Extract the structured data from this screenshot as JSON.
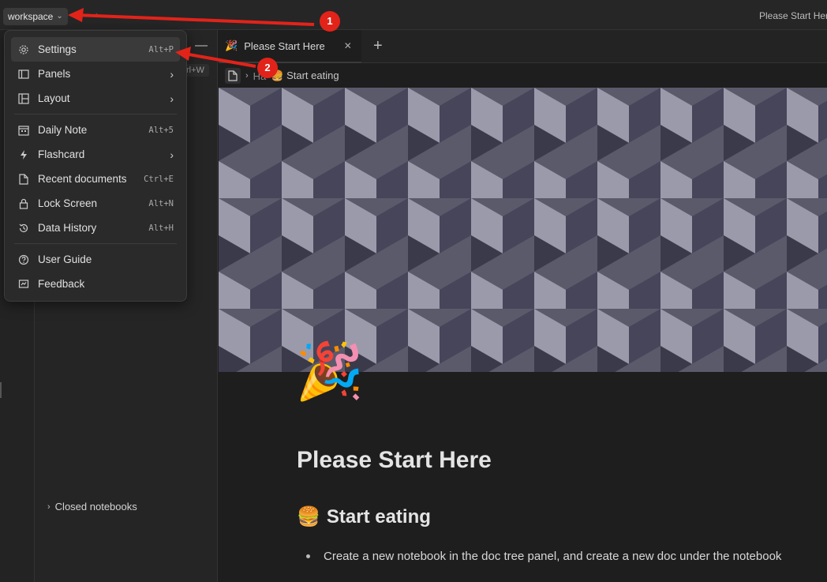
{
  "topbar": {
    "workspace_label": "workspace",
    "title": "Please Start Here"
  },
  "menu": {
    "items": [
      {
        "label": "Settings",
        "shortcut": "Alt+P",
        "icon": "gear-icon"
      },
      {
        "label": "Panels",
        "icon": "panels-icon"
      },
      {
        "label": "Layout",
        "icon": "layout-icon"
      },
      {
        "label": "Daily Note",
        "shortcut": "Alt+5",
        "icon": "calendar-icon"
      },
      {
        "label": "Flashcard",
        "icon": "lightning-icon"
      },
      {
        "label": "Recent documents",
        "shortcut": "Ctrl+E",
        "icon": "document-icon"
      },
      {
        "label": "Lock Screen",
        "shortcut": "Alt+N",
        "icon": "lock-icon"
      },
      {
        "label": "Data History",
        "shortcut": "Alt+H",
        "icon": "history-icon"
      },
      {
        "label": "User Guide",
        "icon": "help-icon"
      },
      {
        "label": "Feedback",
        "icon": "feedback-icon"
      }
    ]
  },
  "tree": {
    "shortcut_hint": "rl+W",
    "closed_notebooks": "Closed notebooks"
  },
  "tab": {
    "emoji": "🎉",
    "label": "Please Start Here"
  },
  "breadcrumb": {
    "parent": "Ha",
    "current": "🍔 Start eating"
  },
  "doc": {
    "emoji": "🎉",
    "title": "Please Start Here",
    "h2_emoji": "🍔",
    "h2": "Start eating",
    "list": [
      "Create a new notebook in the doc tree panel, and create a new doc under the notebook"
    ]
  },
  "annotations": {
    "badge1": "1",
    "badge2": "2"
  },
  "colors": {
    "accent": "#e2231a"
  }
}
